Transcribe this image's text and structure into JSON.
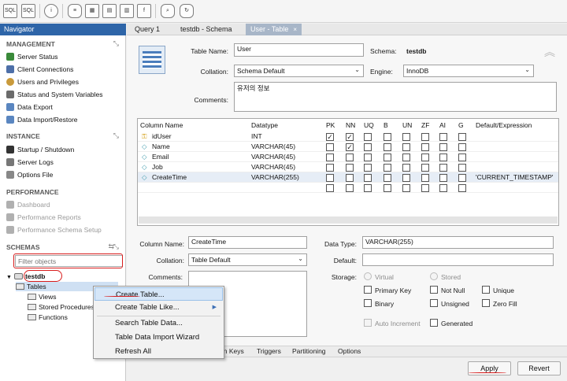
{
  "toolbar": {
    "icons": [
      "new-sql-icon",
      "open-sql-icon",
      "info-icon",
      "create-schema-icon",
      "create-table-icon",
      "create-view-icon",
      "create-procedure-icon",
      "create-function-icon",
      "search-icon",
      "reconnect-icon"
    ]
  },
  "navigator": {
    "title": "Navigator",
    "management": {
      "heading": "MANAGEMENT",
      "items": [
        "Server Status",
        "Client Connections",
        "Users and Privileges",
        "Status and System Variables",
        "Data Export",
        "Data Import/Restore"
      ]
    },
    "instance": {
      "heading": "INSTANCE",
      "items": [
        "Startup / Shutdown",
        "Server Logs",
        "Options File"
      ]
    },
    "performance": {
      "heading": "PERFORMANCE",
      "items": [
        "Dashboard",
        "Performance Reports",
        "Performance Schema Setup"
      ]
    },
    "schemas": {
      "heading": "SCHEMAS",
      "filter_placeholder": "Filter objects",
      "schema": "testdb",
      "children": [
        "Tables",
        "Views",
        "Stored Procedures",
        "Functions"
      ]
    }
  },
  "tabs": [
    {
      "label": "Query 1"
    },
    {
      "label": "testdb - Schema"
    },
    {
      "label": "User - Table",
      "close": "×"
    }
  ],
  "table_editor": {
    "table_name_label": "Table Name:",
    "table_name": "User",
    "schema_label": "Schema:",
    "schema": "testdb",
    "collation_label": "Collation:",
    "collation": "Schema Default",
    "engine_label": "Engine:",
    "engine": "InnoDB",
    "comments_label": "Comments:",
    "comments": "유저의 정보"
  },
  "columns_grid": {
    "headers": [
      "Column Name",
      "Datatype",
      "PK",
      "NN",
      "UQ",
      "B",
      "UN",
      "ZF",
      "AI",
      "G",
      "Default/Expression"
    ],
    "rows": [
      {
        "name": "idUser",
        "type": "INT",
        "pk": true,
        "nn": true,
        "default": ""
      },
      {
        "name": "Name",
        "type": "VARCHAR(45)",
        "pk": false,
        "nn": true,
        "default": ""
      },
      {
        "name": "Email",
        "type": "VARCHAR(45)",
        "pk": false,
        "nn": false,
        "default": ""
      },
      {
        "name": "Job",
        "type": "VARCHAR(45)",
        "pk": false,
        "nn": false,
        "default": ""
      },
      {
        "name": "CreateTime",
        "type": "VARCHAR(255)",
        "pk": false,
        "nn": false,
        "default": "'CURRENT_TIMESTAMP'"
      }
    ]
  },
  "column_detail": {
    "column_name_label": "Column Name:",
    "column_name": "CreateTime",
    "collation_label": "Collation:",
    "collation": "Table Default",
    "comments_label": "Comments:",
    "data_type_label": "Data Type:",
    "data_type": "VARCHAR(255)",
    "default_label": "Default:",
    "storage_label": "Storage:",
    "virtual": "Virtual",
    "stored": "Stored",
    "primary_key": "Primary Key",
    "not_null": "Not Null",
    "unique": "Unique",
    "binary": "Binary",
    "unsigned": "Unsigned",
    "zero_fill": "Zero Fill",
    "auto_increment": "Auto Increment",
    "generated": "Generated"
  },
  "bottom_tabs": [
    "gn Keys",
    "Triggers",
    "Partitioning",
    "Options"
  ],
  "buttons": {
    "apply": "Apply",
    "revert": "Revert"
  },
  "context_menu": {
    "items": [
      "Create Table...",
      "Create Table Like...",
      "Search Table Data...",
      "Table Data Import Wizard",
      "Refresh All"
    ],
    "highlighted": "Create Table...",
    "submenu_arrow": "▶"
  },
  "colors": {
    "navigator_header": "#2e65a8",
    "active_tab": "#a8b6c8",
    "annotation": "#d81b1b",
    "menu_highlight": "#d5e6f8"
  }
}
